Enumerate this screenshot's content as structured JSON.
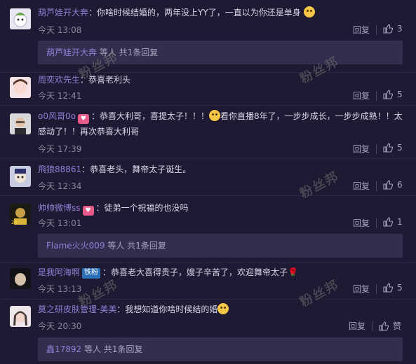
{
  "watermark": "粉丝邦",
  "reply_label": "回复",
  "sub_suffix": "等人 共1条回复",
  "comments": [
    {
      "user": "葫芦娃开大奔",
      "text": "你啥时候结婚的，两年没上YY了，一直以为你还是单身",
      "time": "今天 13:08",
      "likes": "3",
      "sub_user": "葫芦娃开大奔"
    },
    {
      "user": "周奕欢先生",
      "text": "恭喜老利头",
      "time": "今天 12:41",
      "likes": "5"
    },
    {
      "user": "o0风哥0o",
      "text_a": "恭喜大利哥，喜提太子！！！",
      "text_b": "看你直播8年了，一步步成长，一步步成熟！！太感动了！！再次恭喜大利哥",
      "time": "今天 17:39",
      "likes": "5"
    },
    {
      "user": "飛狼88861",
      "text": "恭喜老头，舞帝太子诞生。",
      "time": "今天 12:34",
      "likes": "6"
    },
    {
      "user": "帅帅微博ss",
      "text": "徒弟一个祝福的也没吗",
      "time": "今天 13:01",
      "likes": "1",
      "sub_user": "Flame火火009"
    },
    {
      "user": "是我阿海啊",
      "badge": "铁粉",
      "text": "恭喜老大喜得贵子，嫂子辛苦了，欢迎舞帝太子",
      "time": "今天 13:13",
      "likes": "5"
    },
    {
      "user": "莫之研皮肤管理-美美",
      "text": "我想知道你啥时候结的婚",
      "time": "今天 20:30",
      "likes": "赞",
      "sub_user": "鑫17892"
    }
  ]
}
